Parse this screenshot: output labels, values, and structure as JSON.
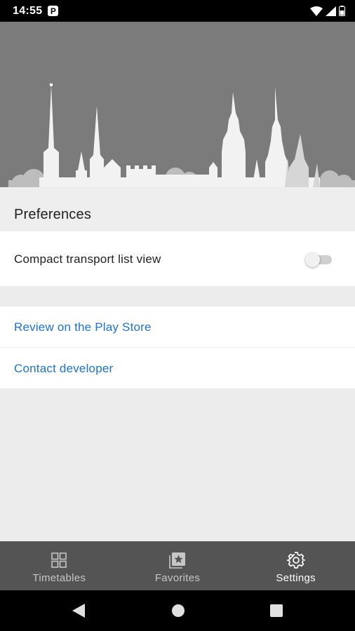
{
  "status_bar": {
    "time": "14:55",
    "badge": "P",
    "icons": [
      "wifi-icon",
      "signal-icon",
      "battery-icon"
    ]
  },
  "preferences": {
    "title": "Preferences",
    "compact_list": {
      "label": "Compact transport list view",
      "enabled": false
    }
  },
  "links": [
    {
      "label": "Review on the Play Store"
    },
    {
      "label": "Contact developer"
    }
  ],
  "bottom_nav": {
    "items": [
      {
        "label": "Timetables",
        "icon": "grid-icon",
        "active": false
      },
      {
        "label": "Favorites",
        "icon": "star-card-icon",
        "active": false
      },
      {
        "label": "Settings",
        "icon": "gear-icon",
        "active": true
      }
    ]
  },
  "system_nav": [
    "back-icon",
    "home-icon",
    "recents-icon"
  ],
  "colors": {
    "link": "#1e73c9",
    "nav_bg": "#545454",
    "hero_bg": "#7b7b7b",
    "skyline": "#f2f2f2"
  }
}
